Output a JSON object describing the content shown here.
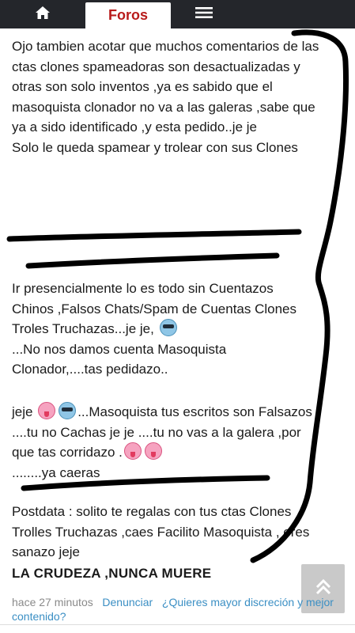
{
  "nav": {
    "home_icon": "home-icon",
    "active_tab": "Foros",
    "menu_icon": "hamburger-menu-icon"
  },
  "post": {
    "paragraph1": "Ojo tambien acotar que muchos comentarios de las ctas clones spameadoras son desactualizadas y otras son solo inventos ,ya es sabido que el masoquista clonador no va a las galeras ,sabe que ya a sido identificado ,y esta pedido..je je",
    "paragraph1b": "Solo le queda spamear y trolear con sus Clones",
    "paragraph2a": "Ir presencialmente lo es todo sin Cuentazos Chinos ,Falsos Chats/Spam de Cuentas Clones Troles Truchazas...je je, ",
    "paragraph2b": "...No nos damos cuenta Masoquista Clonador,....tas pedidazo..",
    "paragraph3a": "jeje ",
    "paragraph3b": "...Masoquista tus escritos son Falsazos ....tu no Cachas je je ....tu no vas a la galera ,por que tas corridazo .",
    "paragraph3c": "........ya caeras",
    "paragraph4": "Postdata : solito te regalas con tus ctas Clones Trolles Truchazas ,caes Facilito Masoquista , eres sanazo jeje",
    "closing": "LA CRUDEZA ,NUNCA MUERE",
    "emoji_cool": "cool-sunglasses-emoji-icon",
    "emoji_tongue": "tongue-out-emoji-icon"
  },
  "meta": {
    "time": "hace 27 minutos",
    "report": "Denunciar",
    "discretion": "¿Quieres mayor discreción y mejor contenido?"
  },
  "colors": {
    "topbar": "#24262b",
    "active_tab_text": "#b81b1b",
    "link": "#3b8fc4",
    "marker": "#000000"
  },
  "scroll_top_icon": "double-chevron-up-icon"
}
